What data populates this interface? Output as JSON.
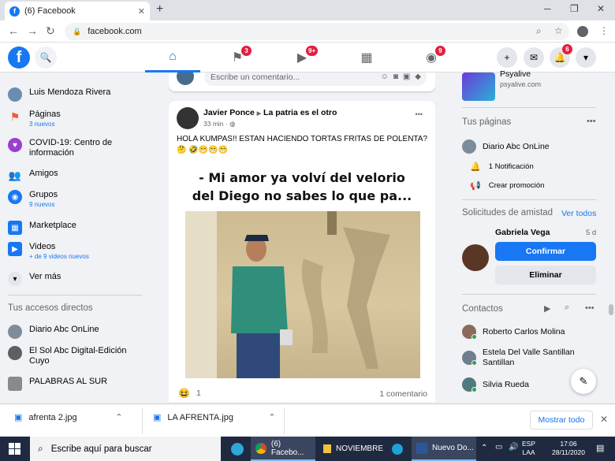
{
  "browser": {
    "tab_title": "(6) Facebook",
    "url": "facebook.com",
    "tab_close": "✕",
    "new_tab": "+",
    "win_min": "─",
    "win_max": "❐",
    "win_close": "✕"
  },
  "fb_header": {
    "logo": "f",
    "badges": {
      "pages": "3",
      "watch": "9+",
      "groups": "9",
      "notifications": "6"
    }
  },
  "left_sidebar": {
    "user": "Luis Mendoza Rivera",
    "items": [
      {
        "label": "Páginas",
        "sub": "3 nuevos"
      },
      {
        "label": "COVID-19: Centro de información",
        "sub": ""
      },
      {
        "label": "Amigos",
        "sub": ""
      },
      {
        "label": "Grupos",
        "sub": "9 nuevos"
      },
      {
        "label": "Marketplace",
        "sub": ""
      },
      {
        "label": "Videos",
        "sub": "+ de 9 videos nuevos"
      },
      {
        "label": "Ver más",
        "sub": ""
      }
    ],
    "shortcuts_title": "Tus accesos directos",
    "shortcuts": [
      "Diario Abc OnLine",
      "El Sol Abc Digital-Edición Cuyo",
      "PALABRAS AL SUR"
    ]
  },
  "feed": {
    "comment_placeholder": "Escribe un comentario...",
    "post": {
      "author": "Javier Ponce",
      "arrow": "▶",
      "group": "La patria es el otro",
      "time": "33 min",
      "text": "HOLA KUMPAS!! ESTAN HACIENDO TORTAS FRITAS DE POLENTA? 🤔 🤣😁😁😁",
      "meme_text_line1": "- Mi amor ya volví del velorio",
      "meme_text_line2": "del Diego no sabes lo que pa...",
      "reactions": "1",
      "comments": "1 comentario",
      "more": "•••"
    }
  },
  "right_sidebar": {
    "ad_title": "Psyalive",
    "ad_url": "psyalive.com",
    "pages_title": "Tus páginas",
    "page_name": "Diario Abc OnLine",
    "notifications": "1 Notificación",
    "create_promo": "Crear promoción",
    "friend_requests_title": "Solicitudes de amistad",
    "see_all": "Ver todos",
    "request_name": "Gabriela Vega",
    "request_time": "5 d",
    "confirm": "Confirmar",
    "delete": "Eliminar",
    "contacts_title": "Contactos",
    "contacts": [
      "Roberto Carlos Molina",
      "Estela Del Valle Santillan Santillan",
      "Silvia Rueda"
    ]
  },
  "downloads": {
    "files": [
      "afrenta 2.jpg",
      "LA AFRENTA.jpg"
    ],
    "show_all": "Mostrar todo",
    "close": "✕"
  },
  "taskbar": {
    "search_placeholder": "Escribe aquí para buscar",
    "apps": [
      "(6) Facebo...",
      "NOVIEMBRE",
      "Nuevo Do..."
    ],
    "lang1": "ESP",
    "lang2": "LAA",
    "time": "17:06",
    "date": "28/11/2020"
  }
}
